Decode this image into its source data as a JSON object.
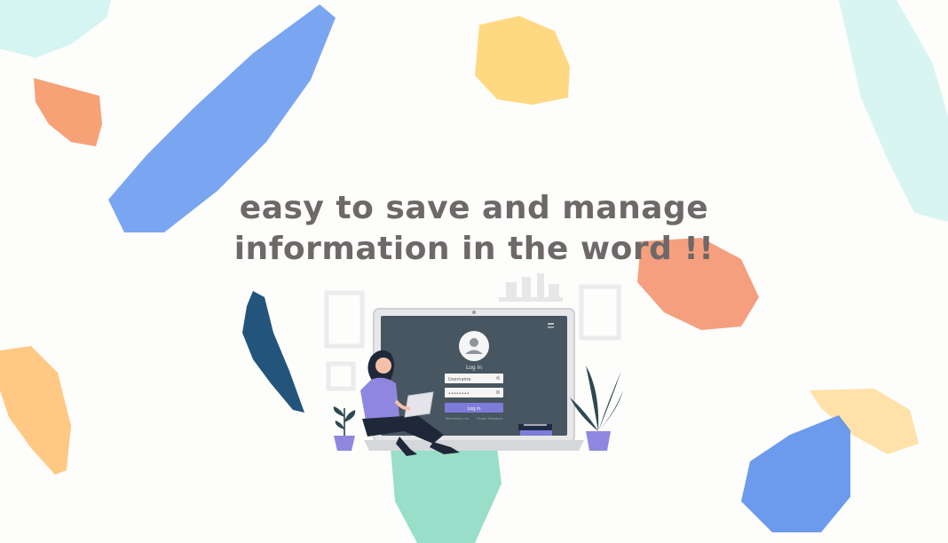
{
  "headline": {
    "line1": "easy to save and manage",
    "line2": "information in the word !!"
  },
  "login": {
    "title": "Log in",
    "username_value": "Username",
    "password_value": "••••••••",
    "button_label": "Log in",
    "remember_label": "Remember me",
    "forgot_label": "Forgot Password"
  },
  "colors": {
    "blue": "#6f9ef0",
    "yellow": "#ffd77a",
    "orange": "#f49a78",
    "mint": "#bfeee4",
    "teal_mint": "#86d8c0",
    "navy": "#23547c",
    "screen": "#475661",
    "button": "#7e7bd9",
    "text": "#6e6868"
  }
}
